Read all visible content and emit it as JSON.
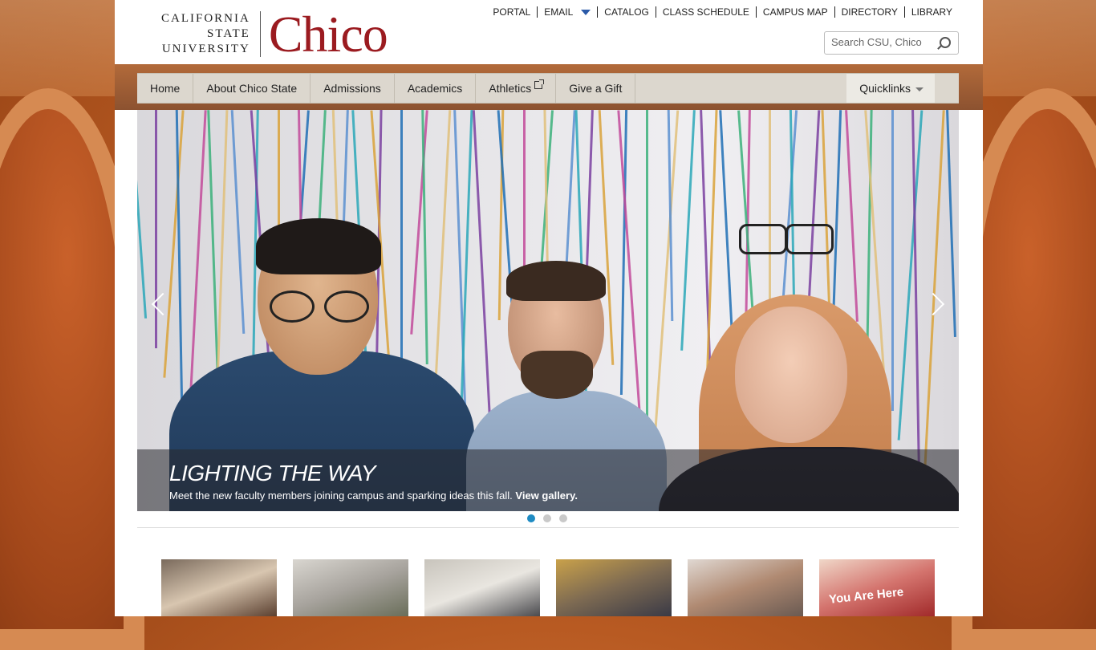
{
  "logo": {
    "line1": "CALIFORNIA",
    "line2": "STATE",
    "line3": "UNIVERSITY",
    "wordmark": "Chico",
    "brand_color": "#9b1b20"
  },
  "utility_nav": [
    {
      "label": "PORTAL"
    },
    {
      "label": "EMAIL"
    },
    {
      "label": "CATALOG"
    },
    {
      "label": "CLASS SCHEDULE"
    },
    {
      "label": "CAMPUS MAP"
    },
    {
      "label": "DIRECTORY"
    },
    {
      "label": "LIBRARY"
    }
  ],
  "search": {
    "placeholder": "Search CSU, Chico",
    "icon": "search-icon"
  },
  "main_nav": {
    "items": [
      {
        "label": "Home"
      },
      {
        "label": "About Chico State"
      },
      {
        "label": "Admissions"
      },
      {
        "label": "Academics"
      },
      {
        "label": "Athletics",
        "icon": "external-link-icon"
      },
      {
        "label": "Give a Gift"
      }
    ],
    "quicklinks": "Quicklinks"
  },
  "hero": {
    "title": "LIGHTING THE WAY",
    "text": "Meet the new faculty members joining campus and sparking ideas this fall.",
    "link": "View gallery.",
    "slides": 3,
    "active_slide": 1,
    "accent": "#1e8bc3"
  },
  "thumbnails": [
    {
      "name": "thumb-mascot"
    },
    {
      "name": "thumb-student-tablet"
    },
    {
      "name": "thumb-whiteboard"
    },
    {
      "name": "thumb-speaker"
    },
    {
      "name": "thumb-students-reading"
    },
    {
      "name": "thumb-you-are-here",
      "text": "You Are Here"
    }
  ]
}
